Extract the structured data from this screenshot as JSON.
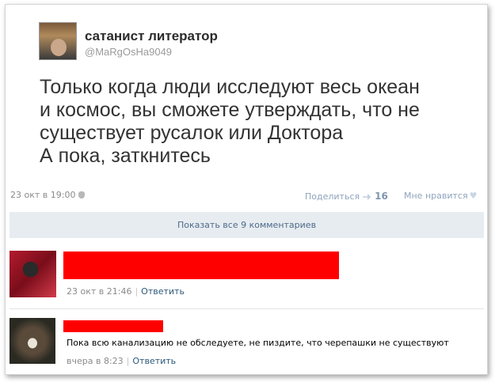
{
  "post": {
    "author_name": "сатанист литератор",
    "author_handle": "@MaRgOsHa9049",
    "text_lines": [
      "Только когда люди исследуют весь океан",
      "и космос, вы сможете утверждать, что не",
      "существует русалок или Доктора",
      "А пока, заткнитесь"
    ],
    "date": "23 окт в 19:00",
    "share_label": "Поделиться",
    "share_count": "16",
    "like_label": "Мне нравится"
  },
  "comments_bar": {
    "label": "Показать все 9 комментариев"
  },
  "comments": [
    {
      "date": "23 окт в 21:46",
      "reply_label": "Ответить"
    },
    {
      "text": "Пока всю канализацию не обследуете, не пиздите, что черепашки не существуют",
      "date": "вчера в 8:23",
      "reply_label": "Ответить"
    }
  ],
  "colors": {
    "redaction": "#ff0000",
    "link": "#2b587a",
    "bar_bg": "#e7ecf1"
  }
}
